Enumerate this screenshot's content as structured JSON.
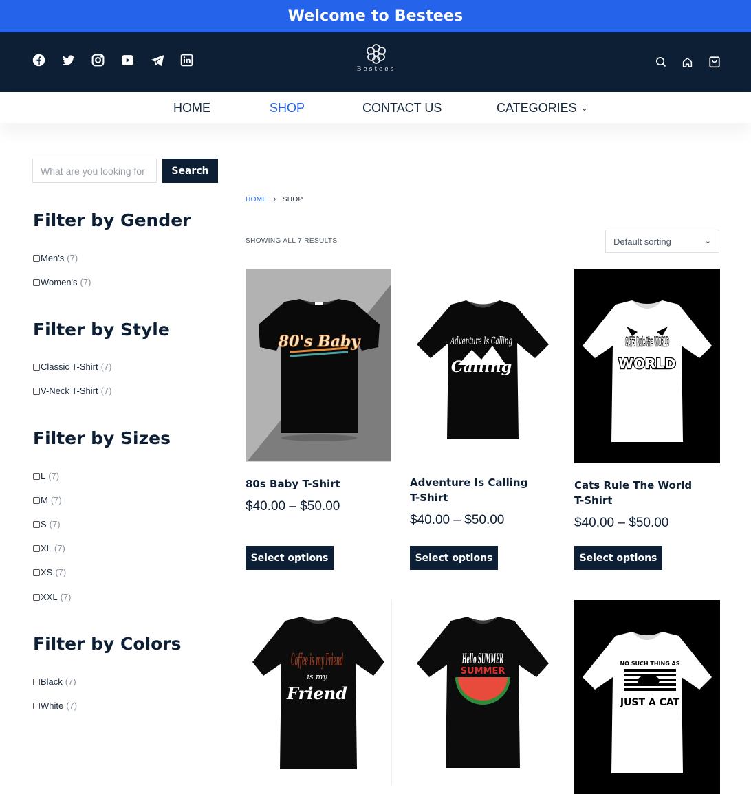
{
  "banner": "Welcome to Bestees",
  "brand": "Bestees",
  "social_icons": [
    "facebook-icon",
    "twitter-icon",
    "instagram-icon",
    "youtube-icon",
    "telegram-icon",
    "linkedin-icon"
  ],
  "header_icons": [
    "search-icon",
    "home-icon",
    "cart-icon"
  ],
  "nav": {
    "home": "HOME",
    "shop": "SHOP",
    "contact": "CONTACT US",
    "categories": "CATEGORIES"
  },
  "search": {
    "placeholder": "What are you looking for",
    "button": "Search"
  },
  "filters": [
    {
      "title": "Filter by Gender",
      "options": [
        {
          "label": "Men's",
          "count": "(7)"
        },
        {
          "label": "Women's",
          "count": "(7)"
        }
      ]
    },
    {
      "title": "Filter by Style",
      "options": [
        {
          "label": "Classic T-Shirt",
          "count": "(7)"
        },
        {
          "label": "V-Neck T-Shirt",
          "count": "(7)"
        }
      ]
    },
    {
      "title": "Filter by Sizes",
      "options": [
        {
          "label": "L",
          "count": "(7)"
        },
        {
          "label": "M",
          "count": "(7)"
        },
        {
          "label": "S",
          "count": "(7)"
        },
        {
          "label": "XL",
          "count": "(7)"
        },
        {
          "label": "XS",
          "count": "(7)"
        },
        {
          "label": "XXL",
          "count": "(7)"
        }
      ]
    },
    {
      "title": "Filter by Colors",
      "options": [
        {
          "label": "Black",
          "count": "(7)"
        },
        {
          "label": "White",
          "count": "(7)"
        }
      ]
    }
  ],
  "breadcrumb": {
    "home": "HOME",
    "current": "SHOP"
  },
  "result_count": "SHOWING ALL 7 RESULTS",
  "sorting": "Default sorting",
  "products": [
    {
      "title": "80s Baby T-Shirt",
      "price": "$40.00 – $50.00",
      "button": "Select options",
      "shirt_text": "80's Baby"
    },
    {
      "title": "Adventure Is Calling T-Shirt",
      "price": "$40.00 – $50.00",
      "button": "Select options",
      "shirt_text": "Adventure Is Calling"
    },
    {
      "title": "Cats Rule The World T-Shirt",
      "price": "$40.00 – $50.00",
      "button": "Select options",
      "shirt_text": "CATS Rule the WORLD"
    },
    {
      "shirt_text": "Coffee is my Friend"
    },
    {
      "shirt_text": "Hello SUMMER"
    },
    {
      "shirt_text": "NO SUCH THING AS JUST A CAT"
    }
  ],
  "colors": {
    "accent": "#2563eb",
    "navy": "#0d1f35",
    "text": "#192a3d"
  }
}
